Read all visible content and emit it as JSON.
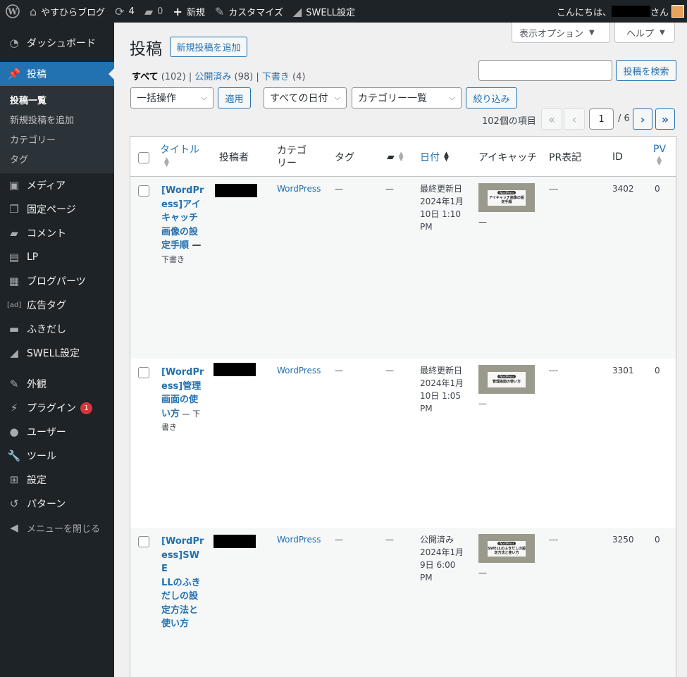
{
  "admin_bar": {
    "site_name": "やすひらブログ",
    "updates_count": "4",
    "comments_count": "0",
    "new_label": "新規",
    "customize_label": "カスタマイズ",
    "swell_label": "SWELL設定",
    "greeting_prefix": "こんにちは、",
    "greeting_suffix": "さん"
  },
  "sidebar": {
    "top_items": [
      {
        "label": "ダッシュボード",
        "icon": "dashboard-icon"
      }
    ],
    "current": {
      "label": "投稿",
      "icon": "pin-icon"
    },
    "submenu": [
      "投稿一覧",
      "新規投稿を追加",
      "カテゴリー",
      "タグ"
    ],
    "items": [
      {
        "label": "メディア",
        "icon": "media-icon"
      },
      {
        "label": "固定ページ",
        "icon": "page-icon"
      },
      {
        "label": "コメント",
        "icon": "comment-icon"
      },
      {
        "label": "LP",
        "icon": "document-icon"
      },
      {
        "label": "ブログパーツ",
        "icon": "grid-icon"
      },
      {
        "label": "広告タグ",
        "icon": "ad-icon"
      },
      {
        "label": "ふきだし",
        "icon": "speech-bubble-icon"
      },
      {
        "label": "SWELL設定",
        "icon": "swell-icon"
      }
    ],
    "items2": [
      {
        "label": "外観",
        "icon": "brush-icon"
      },
      {
        "label": "プラグイン",
        "icon": "plugin-icon",
        "badge": "1"
      },
      {
        "label": "ユーザー",
        "icon": "user-icon"
      },
      {
        "label": "ツール",
        "icon": "wrench-icon"
      },
      {
        "label": "設定",
        "icon": "settings-icon"
      },
      {
        "label": "パターン",
        "icon": "pattern-icon"
      }
    ],
    "collapse_label": "メニューを閉じる"
  },
  "header": {
    "screen_options": "表示オプション",
    "help": "ヘルプ",
    "title": "投稿",
    "add_new": "新規投稿を追加",
    "search_button": "投稿を検索"
  },
  "filters": {
    "all_label": "すべて",
    "all_count": "(102)",
    "published_label": "公開済み",
    "published_count": "(98)",
    "draft_label": "下書き",
    "draft_count": "(4)",
    "bulk_action": "一括操作",
    "apply": "適用",
    "all_dates": "すべての日付",
    "category_list": "カテゴリー一覧",
    "filter_button": "絞り込み"
  },
  "pagination": {
    "items_count": "102個の項目",
    "first": "«",
    "prev": "‹",
    "current": "1",
    "total": "/ 6",
    "next": "›",
    "last": "»"
  },
  "columns": {
    "title": "タイトル",
    "author": "投稿者",
    "category_line1": "カテゴ",
    "category_line2": "リー",
    "tags": "タグ",
    "date": "日付",
    "eyecatch": "アイキャッチ",
    "pr": "PR表記",
    "id": "ID",
    "pv": "PV"
  },
  "rows": [
    {
      "title_lines": [
        "[WordPr",
        "ess]アイ",
        "キャッチ",
        "画像の設",
        "定手順"
      ],
      "title_dash": " —",
      "state_line": "下書き",
      "category": "WordPress",
      "tags": "—",
      "comments": "—",
      "date_lines": [
        "最終更新日",
        "2024年1月",
        "10日 1:10",
        "PM"
      ],
      "thumb_pill": "WordPress",
      "thumb_title": "アイキャッチ画像の設定手順",
      "thumb_dash": "—",
      "pr": "---",
      "id": "3402",
      "pv": "0"
    },
    {
      "title_lines": [
        "[WordPr",
        "ess]管理",
        "画面の使",
        "い方"
      ],
      "title_dash": " — 下",
      "state_line": "書き",
      "category": "WordPress",
      "tags": "—",
      "comments": "—",
      "date_lines": [
        "最終更新日",
        "2024年1月",
        "10日 1:05",
        "PM"
      ],
      "thumb_pill": "WordPress",
      "thumb_title": "管理画面の使い方",
      "thumb_dash": "—",
      "pr": "---",
      "id": "3301",
      "pv": "0"
    },
    {
      "title_lines": [
        "[WordPr",
        "ess]SWE",
        "LLのふき",
        "だしの設",
        "定方法と",
        "使い方"
      ],
      "title_dash": "",
      "state_line": "",
      "category": "WordPress",
      "tags": "—",
      "comments": "—",
      "date_lines": [
        "公開済み",
        "2024年1月",
        "9日 6:00",
        "PM"
      ],
      "thumb_pill": "WordPress",
      "thumb_title": "SWELLのふきだしの設定方法と使い方",
      "thumb_dash": "—",
      "pr": "---",
      "id": "3250",
      "pv": "0"
    }
  ],
  "colors": {
    "admin_bg": "#1d2327",
    "accent": "#2271b1",
    "badge": "#d63638"
  }
}
